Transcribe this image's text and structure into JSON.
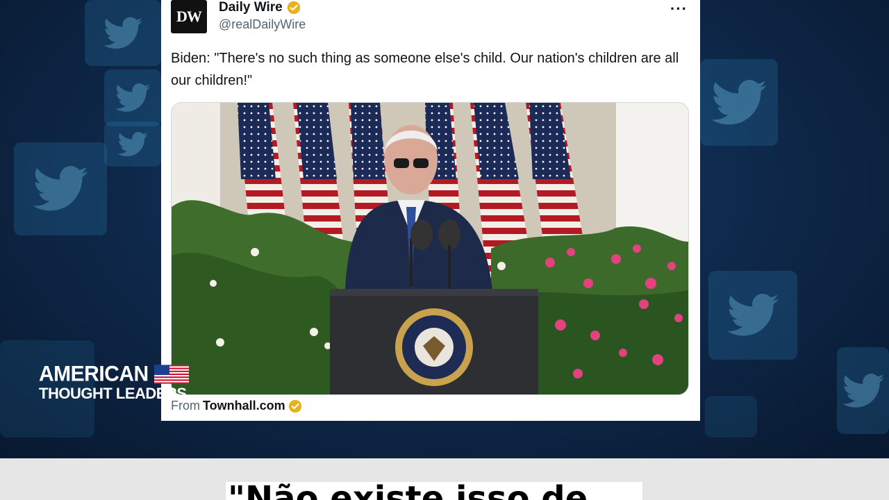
{
  "tweet": {
    "avatar_text": "DW",
    "name": "Daily Wire",
    "handle": "@realDailyWire",
    "more_icon": "···",
    "text": "Biden: \"There's no such thing as someone else's child. Our nation's children are all our children!\"",
    "source_prefix": "From",
    "source_name": "Townhall.com"
  },
  "overlay_logo": {
    "line1": "AMERICAN",
    "line2": "THOUGHT LEADERS"
  },
  "caption": {
    "text": "\"Não existe isso de"
  },
  "colors": {
    "verified": "#E7B21B",
    "backdrop": "#0F2A4D",
    "caption_bar": "#E6E6E6"
  },
  "icons": [
    "twitter-bird-icon",
    "verified-badge-icon",
    "more-options-icon",
    "us-flag-icon"
  ]
}
